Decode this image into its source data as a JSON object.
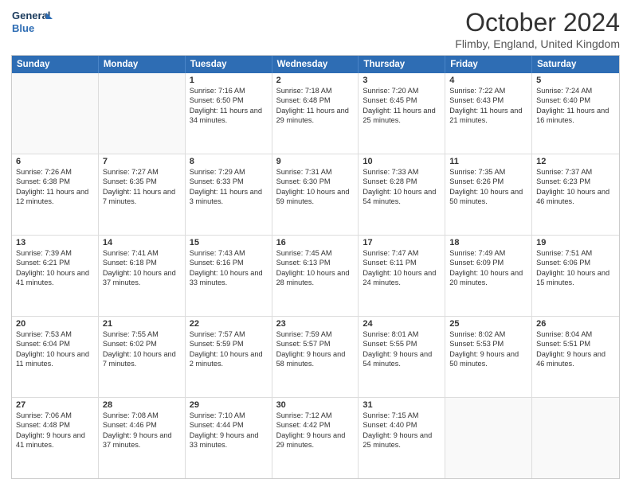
{
  "logo": {
    "line1": "General",
    "line2": "Blue"
  },
  "title": "October 2024",
  "location": "Flimby, England, United Kingdom",
  "days_of_week": [
    "Sunday",
    "Monday",
    "Tuesday",
    "Wednesday",
    "Thursday",
    "Friday",
    "Saturday"
  ],
  "weeks": [
    [
      {
        "day": "",
        "sunrise": "",
        "sunset": "",
        "daylight": "",
        "empty": true
      },
      {
        "day": "",
        "sunrise": "",
        "sunset": "",
        "daylight": "",
        "empty": true
      },
      {
        "day": "1",
        "sunrise": "Sunrise: 7:16 AM",
        "sunset": "Sunset: 6:50 PM",
        "daylight": "Daylight: 11 hours and 34 minutes.",
        "empty": false
      },
      {
        "day": "2",
        "sunrise": "Sunrise: 7:18 AM",
        "sunset": "Sunset: 6:48 PM",
        "daylight": "Daylight: 11 hours and 29 minutes.",
        "empty": false
      },
      {
        "day": "3",
        "sunrise": "Sunrise: 7:20 AM",
        "sunset": "Sunset: 6:45 PM",
        "daylight": "Daylight: 11 hours and 25 minutes.",
        "empty": false
      },
      {
        "day": "4",
        "sunrise": "Sunrise: 7:22 AM",
        "sunset": "Sunset: 6:43 PM",
        "daylight": "Daylight: 11 hours and 21 minutes.",
        "empty": false
      },
      {
        "day": "5",
        "sunrise": "Sunrise: 7:24 AM",
        "sunset": "Sunset: 6:40 PM",
        "daylight": "Daylight: 11 hours and 16 minutes.",
        "empty": false
      }
    ],
    [
      {
        "day": "6",
        "sunrise": "Sunrise: 7:26 AM",
        "sunset": "Sunset: 6:38 PM",
        "daylight": "Daylight: 11 hours and 12 minutes.",
        "empty": false
      },
      {
        "day": "7",
        "sunrise": "Sunrise: 7:27 AM",
        "sunset": "Sunset: 6:35 PM",
        "daylight": "Daylight: 11 hours and 7 minutes.",
        "empty": false
      },
      {
        "day": "8",
        "sunrise": "Sunrise: 7:29 AM",
        "sunset": "Sunset: 6:33 PM",
        "daylight": "Daylight: 11 hours and 3 minutes.",
        "empty": false
      },
      {
        "day": "9",
        "sunrise": "Sunrise: 7:31 AM",
        "sunset": "Sunset: 6:30 PM",
        "daylight": "Daylight: 10 hours and 59 minutes.",
        "empty": false
      },
      {
        "day": "10",
        "sunrise": "Sunrise: 7:33 AM",
        "sunset": "Sunset: 6:28 PM",
        "daylight": "Daylight: 10 hours and 54 minutes.",
        "empty": false
      },
      {
        "day": "11",
        "sunrise": "Sunrise: 7:35 AM",
        "sunset": "Sunset: 6:26 PM",
        "daylight": "Daylight: 10 hours and 50 minutes.",
        "empty": false
      },
      {
        "day": "12",
        "sunrise": "Sunrise: 7:37 AM",
        "sunset": "Sunset: 6:23 PM",
        "daylight": "Daylight: 10 hours and 46 minutes.",
        "empty": false
      }
    ],
    [
      {
        "day": "13",
        "sunrise": "Sunrise: 7:39 AM",
        "sunset": "Sunset: 6:21 PM",
        "daylight": "Daylight: 10 hours and 41 minutes.",
        "empty": false
      },
      {
        "day": "14",
        "sunrise": "Sunrise: 7:41 AM",
        "sunset": "Sunset: 6:18 PM",
        "daylight": "Daylight: 10 hours and 37 minutes.",
        "empty": false
      },
      {
        "day": "15",
        "sunrise": "Sunrise: 7:43 AM",
        "sunset": "Sunset: 6:16 PM",
        "daylight": "Daylight: 10 hours and 33 minutes.",
        "empty": false
      },
      {
        "day": "16",
        "sunrise": "Sunrise: 7:45 AM",
        "sunset": "Sunset: 6:13 PM",
        "daylight": "Daylight: 10 hours and 28 minutes.",
        "empty": false
      },
      {
        "day": "17",
        "sunrise": "Sunrise: 7:47 AM",
        "sunset": "Sunset: 6:11 PM",
        "daylight": "Daylight: 10 hours and 24 minutes.",
        "empty": false
      },
      {
        "day": "18",
        "sunrise": "Sunrise: 7:49 AM",
        "sunset": "Sunset: 6:09 PM",
        "daylight": "Daylight: 10 hours and 20 minutes.",
        "empty": false
      },
      {
        "day": "19",
        "sunrise": "Sunrise: 7:51 AM",
        "sunset": "Sunset: 6:06 PM",
        "daylight": "Daylight: 10 hours and 15 minutes.",
        "empty": false
      }
    ],
    [
      {
        "day": "20",
        "sunrise": "Sunrise: 7:53 AM",
        "sunset": "Sunset: 6:04 PM",
        "daylight": "Daylight: 10 hours and 11 minutes.",
        "empty": false
      },
      {
        "day": "21",
        "sunrise": "Sunrise: 7:55 AM",
        "sunset": "Sunset: 6:02 PM",
        "daylight": "Daylight: 10 hours and 7 minutes.",
        "empty": false
      },
      {
        "day": "22",
        "sunrise": "Sunrise: 7:57 AM",
        "sunset": "Sunset: 5:59 PM",
        "daylight": "Daylight: 10 hours and 2 minutes.",
        "empty": false
      },
      {
        "day": "23",
        "sunrise": "Sunrise: 7:59 AM",
        "sunset": "Sunset: 5:57 PM",
        "daylight": "Daylight: 9 hours and 58 minutes.",
        "empty": false
      },
      {
        "day": "24",
        "sunrise": "Sunrise: 8:01 AM",
        "sunset": "Sunset: 5:55 PM",
        "daylight": "Daylight: 9 hours and 54 minutes.",
        "empty": false
      },
      {
        "day": "25",
        "sunrise": "Sunrise: 8:02 AM",
        "sunset": "Sunset: 5:53 PM",
        "daylight": "Daylight: 9 hours and 50 minutes.",
        "empty": false
      },
      {
        "day": "26",
        "sunrise": "Sunrise: 8:04 AM",
        "sunset": "Sunset: 5:51 PM",
        "daylight": "Daylight: 9 hours and 46 minutes.",
        "empty": false
      }
    ],
    [
      {
        "day": "27",
        "sunrise": "Sunrise: 7:06 AM",
        "sunset": "Sunset: 4:48 PM",
        "daylight": "Daylight: 9 hours and 41 minutes.",
        "empty": false
      },
      {
        "day": "28",
        "sunrise": "Sunrise: 7:08 AM",
        "sunset": "Sunset: 4:46 PM",
        "daylight": "Daylight: 9 hours and 37 minutes.",
        "empty": false
      },
      {
        "day": "29",
        "sunrise": "Sunrise: 7:10 AM",
        "sunset": "Sunset: 4:44 PM",
        "daylight": "Daylight: 9 hours and 33 minutes.",
        "empty": false
      },
      {
        "day": "30",
        "sunrise": "Sunrise: 7:12 AM",
        "sunset": "Sunset: 4:42 PM",
        "daylight": "Daylight: 9 hours and 29 minutes.",
        "empty": false
      },
      {
        "day": "31",
        "sunrise": "Sunrise: 7:15 AM",
        "sunset": "Sunset: 4:40 PM",
        "daylight": "Daylight: 9 hours and 25 minutes.",
        "empty": false
      },
      {
        "day": "",
        "sunrise": "",
        "sunset": "",
        "daylight": "",
        "empty": true
      },
      {
        "day": "",
        "sunrise": "",
        "sunset": "",
        "daylight": "",
        "empty": true
      }
    ]
  ]
}
